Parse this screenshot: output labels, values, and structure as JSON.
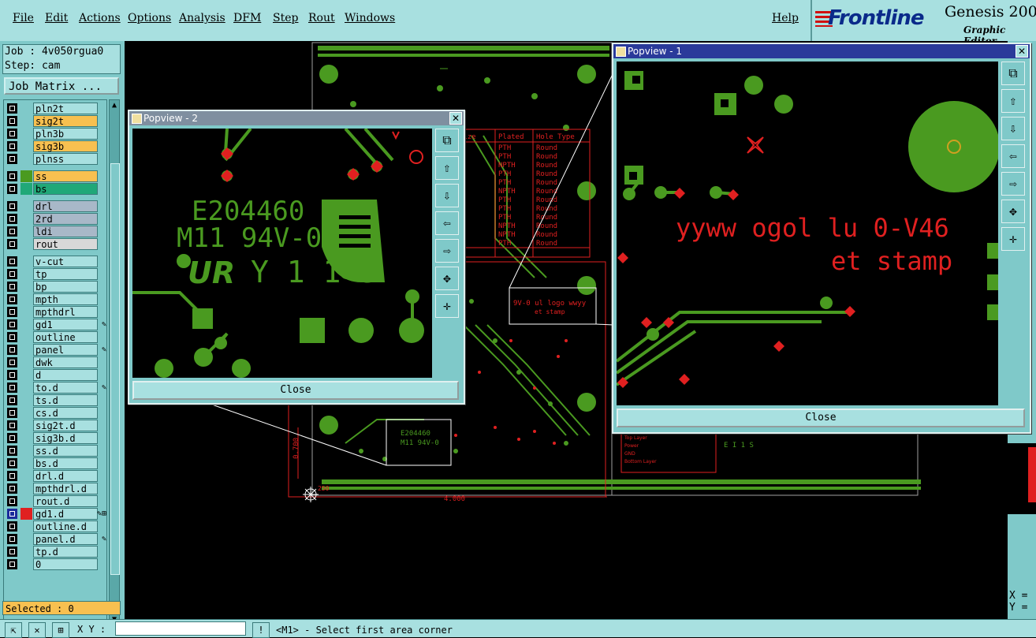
{
  "menu": {
    "items": [
      "File",
      "Edit",
      "Actions",
      "Options",
      "Analysis",
      "DFM",
      "Step",
      "Rout",
      "Windows"
    ],
    "help": "Help"
  },
  "brand": {
    "logo": "Frontline",
    "product": "Genesis 200",
    "subtitle": "Graphic Editor"
  },
  "job": {
    "job_label": "Job : 4v050rgua0",
    "step_label": "Step: cam",
    "matrix_button": "Job Matrix ..."
  },
  "layers": [
    {
      "name": "pln2t",
      "color": "#a8e0e0",
      "swatch": "#7fc9c9"
    },
    {
      "name": "sig2t",
      "color": "#f8c050",
      "swatch": "#7fc9c9"
    },
    {
      "name": "pln3b",
      "color": "#a8e0e0",
      "swatch": "#7fc9c9"
    },
    {
      "name": "sig3b",
      "color": "#f8c050",
      "swatch": "#7fc9c9"
    },
    {
      "name": "plnss",
      "color": "#a8e0e0",
      "swatch": "#7fc9c9"
    },
    {
      "name": "ss",
      "color": "#f8c050",
      "swatch": "#4a9a20"
    },
    {
      "name": "bs",
      "color": "#20a878",
      "swatch": "#20a878"
    },
    {
      "name": "drl",
      "color": "#a8b8c8",
      "swatch": "#7fc9c9"
    },
    {
      "name": "2rd",
      "color": "#a8b8c8",
      "swatch": "#7fc9c9"
    },
    {
      "name": "ldi",
      "color": "#a8b8c8",
      "swatch": "#7fc9c9"
    },
    {
      "name": "rout",
      "color": "#d8d8d8",
      "swatch": "#7fc9c9"
    },
    {
      "name": "v-cut",
      "color": "#a8e0e0",
      "swatch": "#7fc9c9"
    },
    {
      "name": "tp",
      "color": "#a8e0e0",
      "swatch": "#7fc9c9"
    },
    {
      "name": "bp",
      "color": "#a8e0e0",
      "swatch": "#7fc9c9"
    },
    {
      "name": "mpth",
      "color": "#a8e0e0",
      "swatch": "#7fc9c9"
    },
    {
      "name": "mpthdrl",
      "color": "#a8e0e0",
      "swatch": "#7fc9c9"
    },
    {
      "name": "gd1",
      "color": "#a8e0e0",
      "swatch": "#7fc9c9",
      "edit": "✎"
    },
    {
      "name": "outline",
      "color": "#a8e0e0",
      "swatch": "#7fc9c9"
    },
    {
      "name": "panel",
      "color": "#a8e0e0",
      "swatch": "#7fc9c9",
      "edit": "✎"
    },
    {
      "name": "dwk",
      "color": "#a8e0e0",
      "swatch": "#7fc9c9"
    },
    {
      "name": "d",
      "color": "#a8e0e0",
      "swatch": "#7fc9c9"
    },
    {
      "name": "to.d",
      "color": "#a8e0e0",
      "swatch": "#7fc9c9",
      "edit": "✎"
    },
    {
      "name": "ts.d",
      "color": "#a8e0e0",
      "swatch": "#7fc9c9"
    },
    {
      "name": "cs.d",
      "color": "#a8e0e0",
      "swatch": "#7fc9c9"
    },
    {
      "name": "sig2t.d",
      "color": "#a8e0e0",
      "swatch": "#7fc9c9"
    },
    {
      "name": "sig3b.d",
      "color": "#a8e0e0",
      "swatch": "#7fc9c9"
    },
    {
      "name": "ss.d",
      "color": "#a8e0e0",
      "swatch": "#7fc9c9"
    },
    {
      "name": "bs.d",
      "color": "#a8e0e0",
      "swatch": "#7fc9c9"
    },
    {
      "name": "drl.d",
      "color": "#a8e0e0",
      "swatch": "#7fc9c9"
    },
    {
      "name": "mpthdrl.d",
      "color": "#a8e0e0",
      "swatch": "#7fc9c9"
    },
    {
      "name": "rout.d",
      "color": "#a8e0e0",
      "swatch": "#7fc9c9"
    },
    {
      "name": "gd1.d",
      "color": "#a8e0e0",
      "swatch": "#e02020",
      "edit": "✎⊞",
      "active": true
    },
    {
      "name": "outline.d",
      "color": "#a8e0e0",
      "swatch": "#7fc9c9"
    },
    {
      "name": "panel.d",
      "color": "#a8e0e0",
      "swatch": "#7fc9c9",
      "edit": "✎"
    },
    {
      "name": "tp.d",
      "color": "#a8e0e0",
      "swatch": "#7fc9c9"
    },
    {
      "name": "0",
      "color": "#a8e0e0",
      "swatch": "#7fc9c9"
    }
  ],
  "selected": "Selected : 0",
  "status": {
    "xy_label": "X Y :",
    "xy_value": "",
    "message": "<M1> - Select first area corner"
  },
  "popview2": {
    "title": "Popview - 2",
    "close": "Close",
    "text1": "E204460",
    "text2": "M11 94V-0",
    "text3": "UR",
    "text4": "Y 1 1 S"
  },
  "popview1": {
    "title": "Popview - 1",
    "close": "Close",
    "text1": "yyww ogol lu 0-V46",
    "text2": "et stamp"
  },
  "board": {
    "table_headers": [
      "Size",
      "Plated",
      "Hole Type"
    ],
    "table_rows": [
      [
        "PTH",
        "Round"
      ],
      [
        "PTH",
        "Round"
      ],
      [
        "NPTH",
        "Round"
      ],
      [
        "PTH",
        "Round"
      ],
      [
        "PTH",
        "Round"
      ],
      [
        "NPTH",
        "Round"
      ],
      [
        "PTH",
        "Round"
      ],
      [
        "PTH",
        "Round"
      ],
      [
        "PTH",
        "Round"
      ],
      [
        "NPTH",
        "Round"
      ],
      [
        "NPTH",
        "Round"
      ],
      [
        "PTH",
        "Round"
      ]
    ],
    "dim_w": "4.000",
    "dim_h": "0.700",
    "dim_s": "250",
    "legend": [
      "Top Layer",
      "Power",
      "GND",
      "Bottom Layer"
    ]
  },
  "right": {
    "x_label": "X =",
    "y_label": "Y ="
  },
  "colors": {
    "panel": "#7fc9c9",
    "light": "#a8e0e0",
    "copper": "#4a9a20",
    "annot": "#e02020"
  }
}
